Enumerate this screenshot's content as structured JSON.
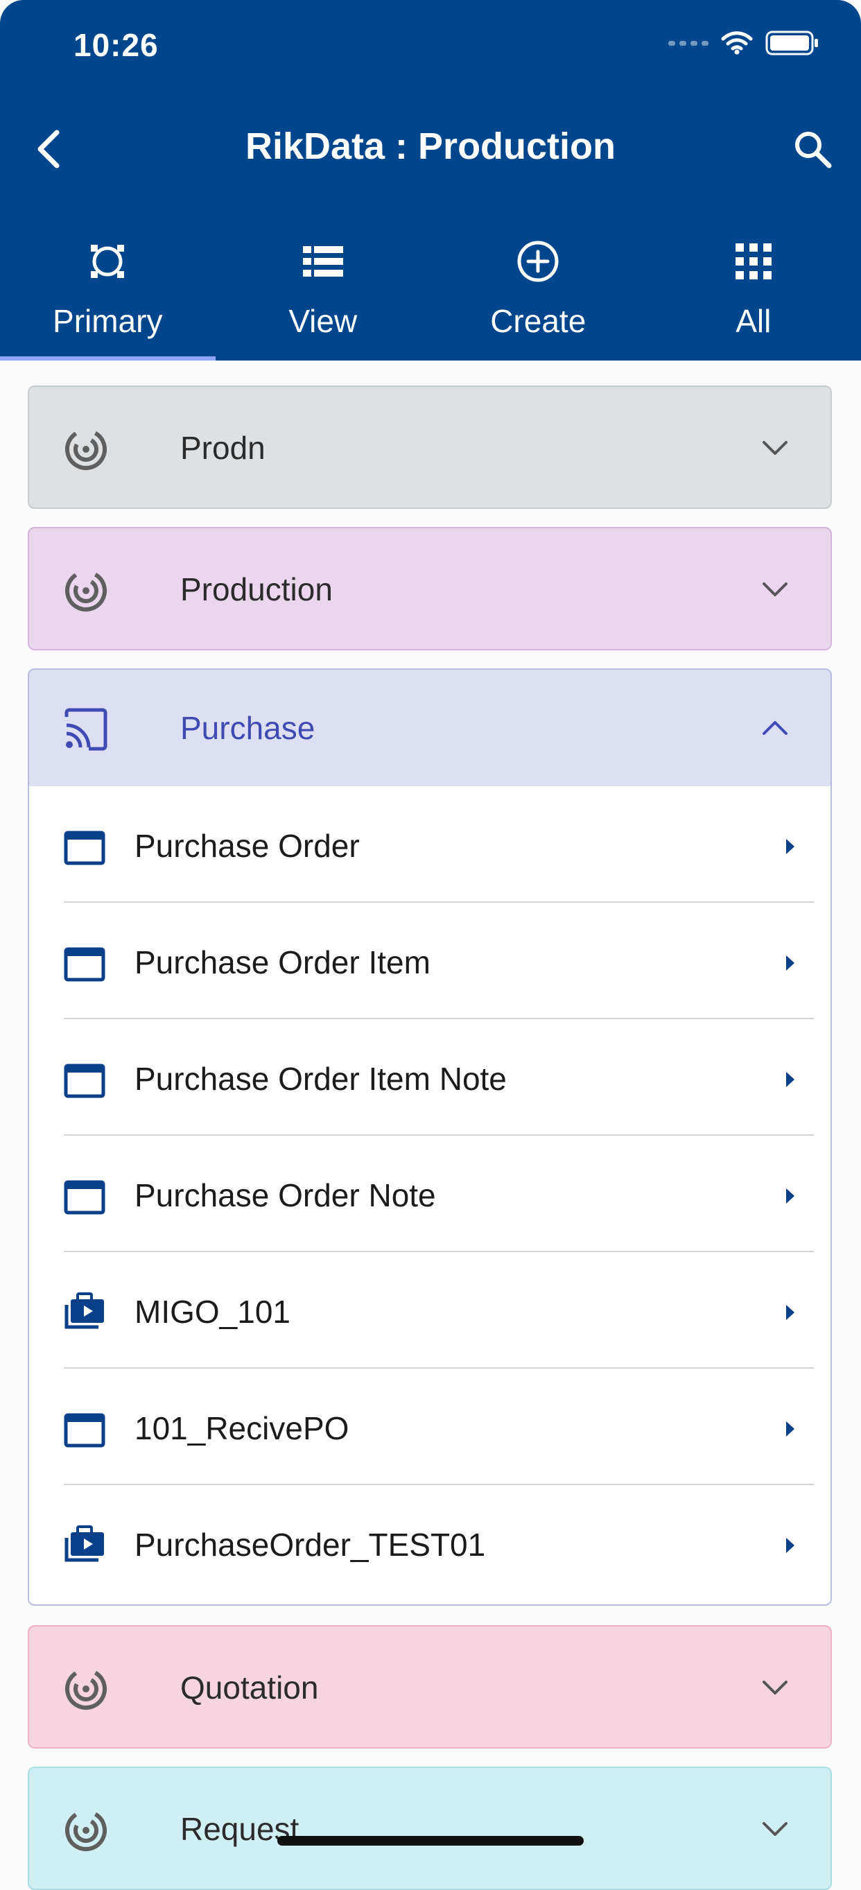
{
  "status_bar": {
    "time": "10:26"
  },
  "header": {
    "title": "RikData : Production",
    "back_icon": "chevron-left-icon",
    "search_icon": "search-icon",
    "bg_color": "#00468c"
  },
  "tabs": [
    {
      "label": "Primary",
      "icon": "primary-icon",
      "active": true
    },
    {
      "label": "View",
      "icon": "list-view-icon",
      "active": false
    },
    {
      "label": "Create",
      "icon": "add-circle-icon",
      "active": false
    },
    {
      "label": "All",
      "icon": "grid-icon",
      "active": false
    }
  ],
  "groups": [
    {
      "label": "Prodn",
      "icon": "target-icon",
      "expanded": false,
      "bg": "#dde1e3",
      "border": "#c7cccf"
    },
    {
      "label": "Production",
      "icon": "target-icon",
      "expanded": false,
      "bg": "#ead7ee",
      "border": "#d6b5dc"
    },
    {
      "label": "Purchase",
      "icon": "cast-icon",
      "expanded": true,
      "bg": "#dde0f2",
      "border": "#b8bde0",
      "accent": "#3f4bb3",
      "items": [
        {
          "label": "Purchase Order",
          "icon": "window-icon"
        },
        {
          "label": "Purchase Order Item",
          "icon": "window-icon"
        },
        {
          "label": "Purchase Order Item Note",
          "icon": "window-icon"
        },
        {
          "label": "Purchase Order Note",
          "icon": "window-icon"
        },
        {
          "label": "MIGO_101",
          "icon": "briefcase-play-icon"
        },
        {
          "label": "101_RecivePO",
          "icon": "window-icon"
        },
        {
          "label": "PurchaseOrder_TEST01",
          "icon": "briefcase-play-icon"
        }
      ]
    },
    {
      "label": "Quotation",
      "icon": "target-icon",
      "expanded": false,
      "bg": "#f6d5e0",
      "border": "#ecb3c6"
    },
    {
      "label": "Request",
      "icon": "target-icon",
      "expanded": false,
      "bg": "#d0eff2",
      "border": "#a9dfe4"
    }
  ]
}
